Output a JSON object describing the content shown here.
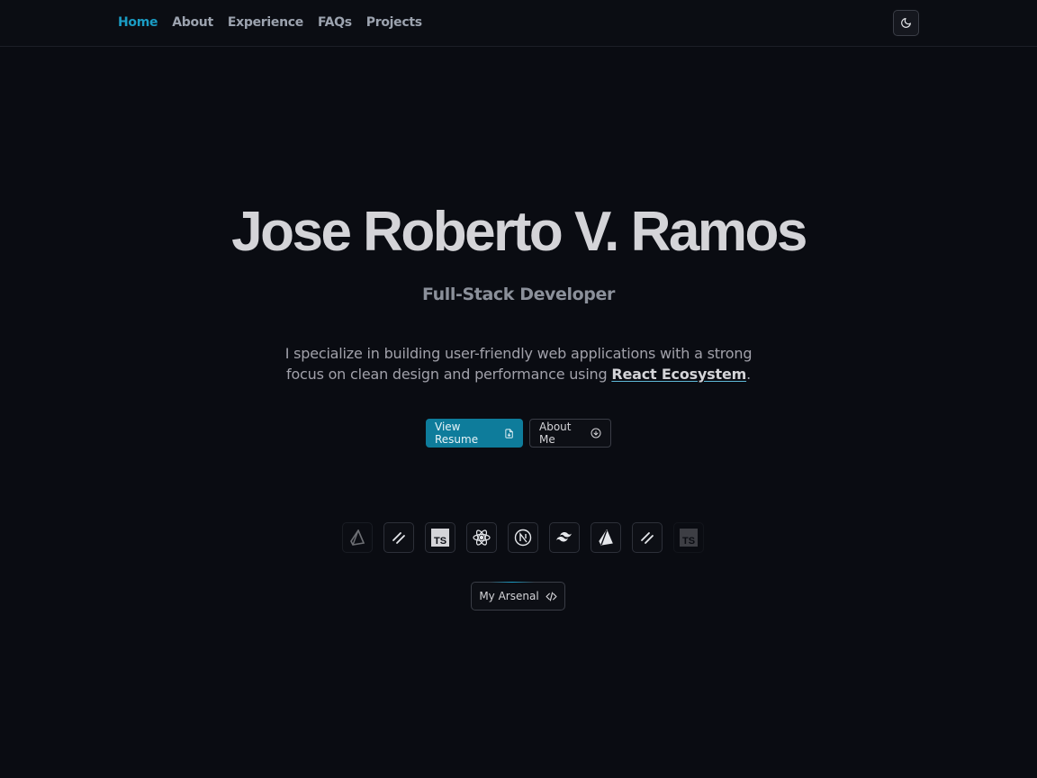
{
  "nav": {
    "links": [
      "Home",
      "About",
      "Experience",
      "FAQs",
      "Projects"
    ],
    "active": "Home",
    "theme_icon": "moon-icon"
  },
  "hero": {
    "name": "Jose Roberto V. Ramos",
    "role": "Full-Stack Developer",
    "desc_before": "I specialize in building user-friendly web applications with a strong focus on clean design and performance using ",
    "desc_highlight": "React Ecosystem",
    "desc_after": "."
  },
  "buttons": {
    "resume": "View Resume",
    "resume_icon": "file-icon",
    "about": "About Me",
    "about_icon": "arrow-down-circle-icon"
  },
  "tech_stack": [
    "prisma-icon",
    "turborepo-icon",
    "typescript-icon",
    "react-icon",
    "nextjs-icon",
    "tailwind-icon",
    "prisma-icon",
    "turborepo-icon",
    "typescript-icon"
  ],
  "arsenal": {
    "label": "My Arsenal",
    "icon": "code-icon"
  },
  "colors": {
    "accent": "#1a9cc4",
    "primary_button": "#0e7c9b",
    "background": "#0a0c12"
  }
}
